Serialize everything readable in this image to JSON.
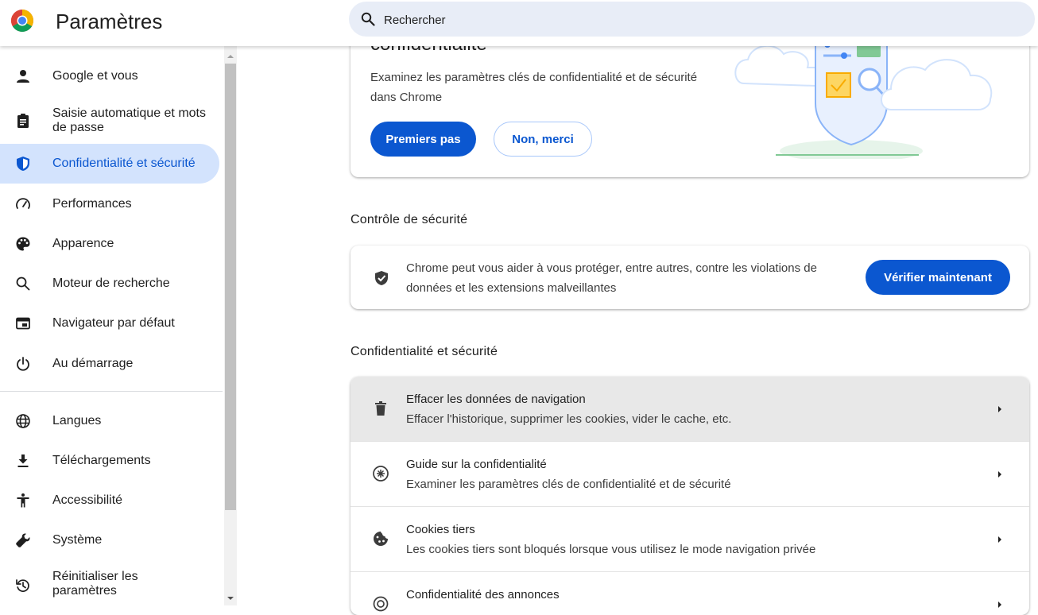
{
  "header": {
    "title": "Paramètres",
    "search": {
      "placeholder": "Rechercher",
      "value": ""
    }
  },
  "sidebar": {
    "items": [
      {
        "label": "Google et vous",
        "icon": "person-icon"
      },
      {
        "label": "Saisie automatique et mots de passe",
        "icon": "clipboard-icon"
      },
      {
        "label": "Confidentialité et sécurité",
        "icon": "shield-icon",
        "active": true
      },
      {
        "label": "Performances",
        "icon": "speedometer-icon"
      },
      {
        "label": "Apparence",
        "icon": "palette-icon"
      },
      {
        "label": "Moteur de recherche",
        "icon": "search-icon"
      },
      {
        "label": "Navigateur par défaut",
        "icon": "browser-window-icon"
      },
      {
        "label": "Au démarrage",
        "icon": "power-icon"
      },
      {
        "label": "Langues",
        "icon": "globe-icon"
      },
      {
        "label": "Téléchargements",
        "icon": "download-icon"
      },
      {
        "label": "Accessibilité",
        "icon": "accessibility-icon"
      },
      {
        "label": "Système",
        "icon": "wrench-icon"
      },
      {
        "label": "Réinitialiser les paramètres",
        "icon": "restore-icon"
      }
    ]
  },
  "promo": {
    "title": "confidentialité",
    "description": "Examinez les paramètres clés de confidentialité et de sécurité dans Chrome",
    "primary_label": "Premiers pas",
    "secondary_label": "Non, merci"
  },
  "safety_check": {
    "heading": "Contrôle de sécurité",
    "text": "Chrome peut vous aider à vous protéger, entre autres, contre les violations de données et les extensions malveillantes",
    "button_label": "Vérifier maintenant"
  },
  "privacy": {
    "heading": "Confidentialité et sécurité",
    "rows": [
      {
        "title": "Effacer les données de navigation",
        "subtitle": "Effacer l'historique, supprimer les cookies, vider le cache, etc.",
        "icon": "trash-icon"
      },
      {
        "title": "Guide sur la confidentialité",
        "subtitle": "Examiner les paramètres clés de confidentialité et de sécurité",
        "icon": "privacy-guide-icon"
      },
      {
        "title": "Cookies tiers",
        "subtitle": "Les cookies tiers sont bloqués lorsque vous utilisez le mode navigation privée",
        "icon": "cookie-icon"
      },
      {
        "title": "Confidentialité des annonces",
        "subtitle": "",
        "icon": "ads-privacy-icon"
      }
    ]
  },
  "colors": {
    "accent": "#0b57d0",
    "active_nav_bg": "#d3e3fd",
    "search_bg": "#e8edf7",
    "highlight_row_bg": "#e8e8e8"
  }
}
